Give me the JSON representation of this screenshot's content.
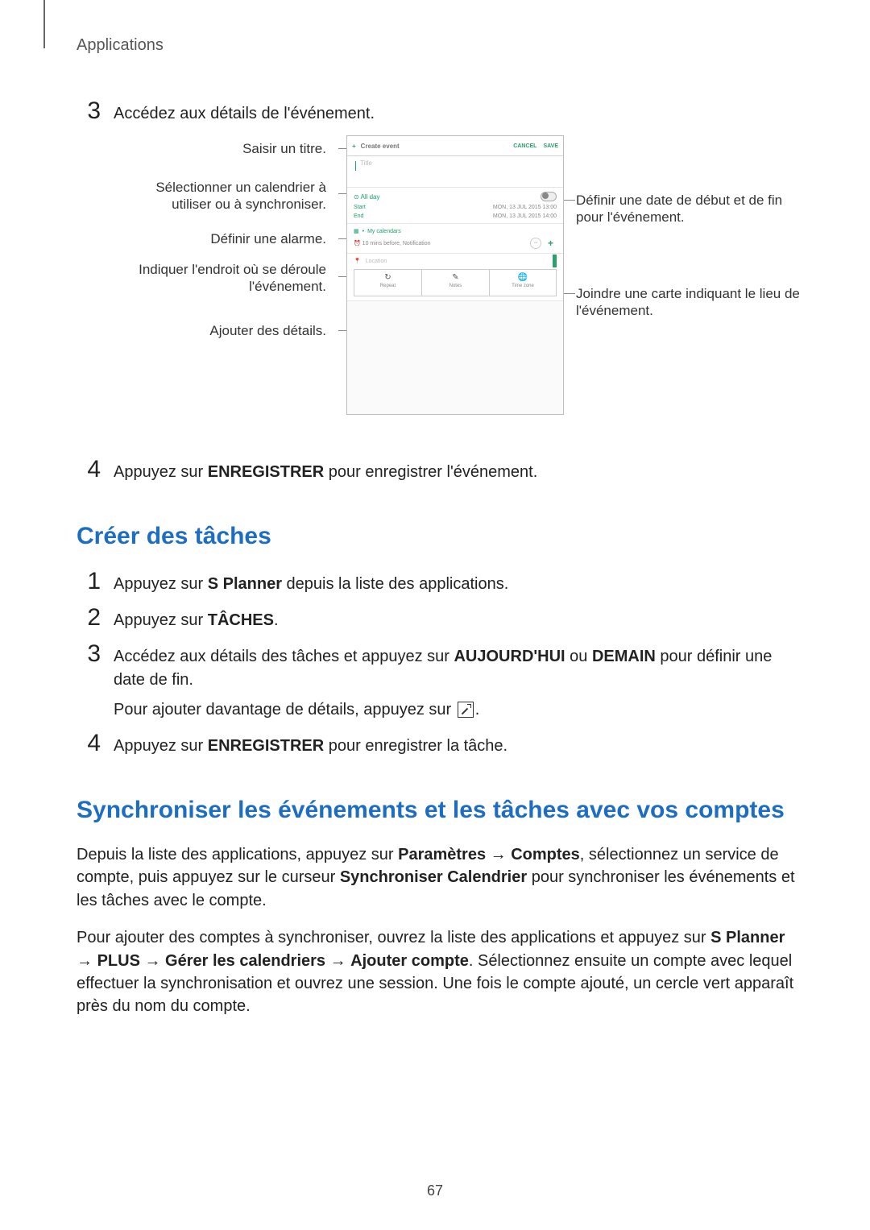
{
  "header": "Applications",
  "step3": {
    "num": "3",
    "text": "Accédez aux détails de l'événement."
  },
  "callouts": {
    "left_title": "Saisir un titre.",
    "left_calendar": "Sélectionner un calendrier à utiliser ou à synchroniser.",
    "left_alarm": "Définir une alarme.",
    "left_location": "Indiquer l'endroit où se déroule l'événement.",
    "left_details": "Ajouter des détails.",
    "right_date": "Définir une date de début et de fin pour l'événement.",
    "right_map": "Joindre une carte indiquant le lieu de l'événement."
  },
  "phone": {
    "header_create": "Create event",
    "header_cancel": "CANCEL",
    "header_save": "SAVE",
    "title_placeholder": "Title",
    "allday": "All day",
    "start_label": "Start",
    "start_value": "MON, 13 JUL 2015  13:00",
    "end_label": "End",
    "end_value": "MON, 13 JUL 2015  14:00",
    "my_calendars": "My calendars",
    "alarm_text": "10 mins before, Notification",
    "location": "Location",
    "btn_repeat": "Repeat",
    "btn_notes": "Notes",
    "btn_timezone": "Time zone"
  },
  "step4a": {
    "num": "4",
    "pre": "Appuyez sur ",
    "bold": "ENREGISTRER",
    "post": " pour enregistrer l'événement."
  },
  "section_tasks": "Créer des tâches",
  "t1": {
    "num": "1",
    "pre": "Appuyez sur ",
    "bold": "S Planner",
    "post": " depuis la liste des applications."
  },
  "t2": {
    "num": "2",
    "pre": "Appuyez sur ",
    "bold": "TÂCHES",
    "post": "."
  },
  "t3": {
    "num": "3",
    "line1_a": "Accédez aux détails des tâches et appuyez sur ",
    "line1_b": "AUJOURD'HUI",
    "line1_c": " ou ",
    "line1_d": "DEMAIN",
    "line1_e": " pour définir une date de fin.",
    "line2": "Pour ajouter davantage de détails, appuyez sur "
  },
  "t4": {
    "num": "4",
    "pre": "Appuyez sur ",
    "bold": "ENREGISTRER",
    "post": " pour enregistrer la tâche."
  },
  "section_sync": "Synchroniser les événements et les tâches avec vos comptes",
  "sync_p1": {
    "a": "Depuis la liste des applications, appuyez sur ",
    "b": "Paramètres",
    "arrow": " → ",
    "c": "Comptes",
    "d": ", sélectionnez un service de compte, puis appuyez sur le curseur ",
    "e": "Synchroniser Calendrier",
    "f": " pour synchroniser les événements et les tâches avec le compte."
  },
  "sync_p2": {
    "a": "Pour ajouter des comptes à synchroniser, ouvrez la liste des applications et appuyez sur ",
    "b": "S Planner",
    "arrow": " → ",
    "c": "PLUS",
    "d": "Gérer les calendriers",
    "e": "Ajouter compte",
    "f": ". Sélectionnez ensuite un compte avec lequel effectuer la synchronisation et ouvrez une session. Une fois le compte ajouté, un cercle vert apparaît près du nom du compte."
  },
  "page_number": "67"
}
